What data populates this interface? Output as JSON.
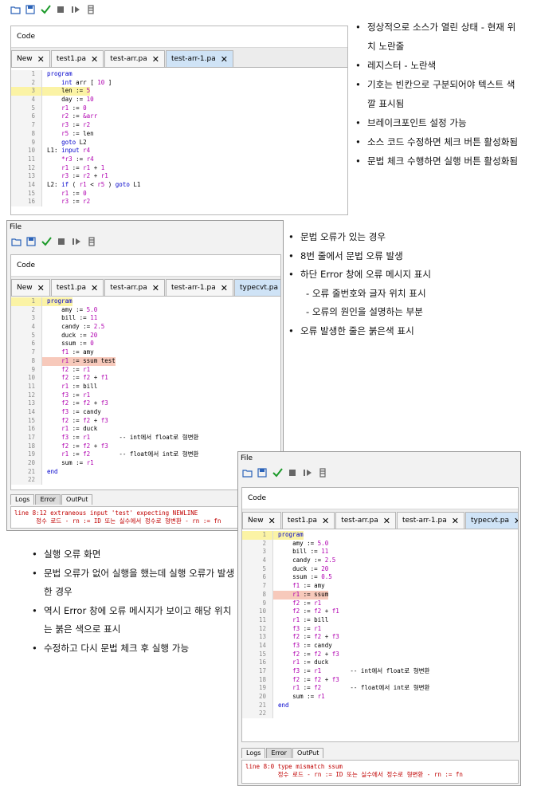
{
  "notes1": [
    "정상적으로 소스가 열린 상태 - 현재 위치 노란줄",
    "레지스터 - 노란색",
    "기호는 빈칸으로 구분되어야 텍스트 색깔 표시됨",
    "브레이크포인트 설정 가능",
    "소스 코드 수정하면 체크 버튼 활성화됨",
    "문법 체크 수행하면 실행 버튼 활성화됨"
  ],
  "notes2": [
    "문법 오류가 있는 경우",
    "8번 줄에서 문법 오류 발생",
    "하단 Error 창에 오류 메시지 표시",
    "- 오류 줄번호와 글자 위치 표시",
    "- 오류의 원인을 설명하는 부분",
    "오류 발생한 줄은 붉은색 표시"
  ],
  "notes3": [
    "실행 오류 화면",
    "문법 오류가 없어 실행을 했는데 실행 오류가 발생한 경우",
    "역시 Error 창에 오류 메시지가 보이고 해당 위치는 붉은 색으로 표시",
    "수정하고 다시 문법 체크 후 실행 가능"
  ],
  "icons": {
    "open": "folder-open-icon",
    "save": "save-icon",
    "check": "check-icon",
    "stop": "stop-icon",
    "run": "step-run-icon",
    "debug": "debug-icon"
  },
  "colors": {
    "current_line": "#fbf3a5",
    "error_line": "#f7c9bb",
    "active_tab": "#cfe3f6",
    "keyword": "#0000cc",
    "register": "#b000b0",
    "error_text": "#c00000"
  },
  "win1": {
    "panel_title": "Code",
    "tabs": [
      {
        "label": "New",
        "active": false
      },
      {
        "label": "test1.pa",
        "active": false
      },
      {
        "label": "test-arr.pa",
        "active": false
      },
      {
        "label": "test-arr-1.pa",
        "active": true
      }
    ],
    "current_line": 3,
    "error_line": null,
    "lines": [
      [
        "1",
        "",
        "program"
      ],
      [
        "2",
        "",
        "    int arr [ 10 ]"
      ],
      [
        "3",
        "",
        "    len := 5"
      ],
      [
        "4",
        "",
        "    day := 10"
      ],
      [
        "5",
        "",
        "    r1 := 0"
      ],
      [
        "6",
        "",
        "    r2 := &arr"
      ],
      [
        "7",
        "",
        "    r3 := r2"
      ],
      [
        "8",
        "",
        "    r5 := len"
      ],
      [
        "9",
        "",
        "    goto L2"
      ],
      [
        "10",
        "",
        "L1: input r4"
      ],
      [
        "11",
        "",
        "    *r3 := r4"
      ],
      [
        "12",
        "",
        "    r1 := r1 + 1"
      ],
      [
        "13",
        "",
        "    r3 := r2 + r1"
      ],
      [
        "14",
        "",
        "L2: if ( r1 < r5 ) goto L1"
      ],
      [
        "15",
        "",
        "    r1 := 0"
      ],
      [
        "16",
        "",
        "    r3 := r2"
      ]
    ]
  },
  "win2": {
    "menu": "File",
    "panel_title": "Code",
    "tabs": [
      {
        "label": "New",
        "active": false
      },
      {
        "label": "test1.pa",
        "active": false
      },
      {
        "label": "test-arr.pa",
        "active": false
      },
      {
        "label": "test-arr-1.pa",
        "active": false
      },
      {
        "label": "typecvt.pa",
        "active": true
      }
    ],
    "current_line": 1,
    "error_line": 8,
    "lines": [
      [
        "1",
        "",
        "program"
      ],
      [
        "2",
        "",
        "    amy := 5.0"
      ],
      [
        "3",
        "",
        "    bill := 11"
      ],
      [
        "4",
        "",
        "    candy := 2.5"
      ],
      [
        "5",
        "",
        "    duck := 20"
      ],
      [
        "6",
        "",
        "    ssum := 0"
      ],
      [
        "7",
        "",
        "    f1 := amy"
      ],
      [
        "8",
        "",
        "    r1 := ssum test"
      ],
      [
        "9",
        "",
        "    f2 := r1"
      ],
      [
        "10",
        "",
        "    f2 := f2 + f1"
      ],
      [
        "11",
        "",
        "    r1 := bill"
      ],
      [
        "12",
        "",
        "    f3 := r1"
      ],
      [
        "13",
        "",
        "    f2 := f2 + f3"
      ],
      [
        "14",
        "",
        "    f3 := candy"
      ],
      [
        "15",
        "",
        "    f2 := f2 + f3"
      ],
      [
        "16",
        "",
        "    r1 := duck"
      ],
      [
        "17",
        "",
        "    f3 := r1        -- int에서 float로 형변환"
      ],
      [
        "18",
        "",
        "    f2 := f2 + f3"
      ],
      [
        "19",
        "",
        "    r1 := f2        -- float에서 int로 형변환"
      ],
      [
        "20",
        "",
        "    sum := r1"
      ],
      [
        "21",
        "",
        "end"
      ],
      [
        "22",
        "",
        ""
      ]
    ],
    "bottom_tabs": [
      {
        "label": "Logs",
        "active": false
      },
      {
        "label": "Error",
        "active": true
      },
      {
        "label": "OutPut",
        "active": false
      }
    ],
    "error_lines": [
      "line 8:12 extraneous input 'test' expecting NEWLINE",
      "      정수 로드 - rn := ID 또는 실수에서 정수로 형변환 - rn := fn"
    ]
  },
  "win3": {
    "menu": "File",
    "panel_title": "Code",
    "tabs": [
      {
        "label": "New",
        "active": false
      },
      {
        "label": "test1.pa",
        "active": false
      },
      {
        "label": "test-arr.pa",
        "active": false
      },
      {
        "label": "test-arr-1.pa",
        "active": false
      },
      {
        "label": "typecvt.pa",
        "active": true
      }
    ],
    "current_line": 1,
    "error_line": 8,
    "lines": [
      [
        "1",
        "",
        "program"
      ],
      [
        "2",
        "",
        "    amy := 5.0"
      ],
      [
        "3",
        "",
        "    bill := 11"
      ],
      [
        "4",
        "",
        "    candy := 2.5"
      ],
      [
        "5",
        "",
        "    duck := 20"
      ],
      [
        "6",
        "",
        "    ssum := 0.5"
      ],
      [
        "7",
        "",
        "    f1 := amy"
      ],
      [
        "8",
        "",
        "    r1 := ssum"
      ],
      [
        "9",
        "",
        "    f2 := r1"
      ],
      [
        "10",
        "",
        "    f2 := f2 + f1"
      ],
      [
        "11",
        "",
        "    r1 := bill"
      ],
      [
        "12",
        "",
        "    f3 := r1"
      ],
      [
        "13",
        "",
        "    f2 := f2 + f3"
      ],
      [
        "14",
        "",
        "    f3 := candy"
      ],
      [
        "15",
        "",
        "    f2 := f2 + f3"
      ],
      [
        "16",
        "",
        "    r1 := duck"
      ],
      [
        "17",
        "",
        "    f3 := r1        -- int에서 float로 형변환"
      ],
      [
        "18",
        "",
        "    f2 := f2 + f3"
      ],
      [
        "19",
        "",
        "    r1 := f2        -- float에서 int로 형변환"
      ],
      [
        "20",
        "",
        "    sum := r1"
      ],
      [
        "21",
        "",
        "end"
      ],
      [
        "22",
        "",
        ""
      ]
    ],
    "bottom_tabs": [
      {
        "label": "Logs",
        "active": false
      },
      {
        "label": "Error",
        "active": true
      },
      {
        "label": "OutPut",
        "active": false
      }
    ],
    "error_lines": [
      "line 8:0 type mismatch ssum",
      "         정수 로드 - rn := ID 또는 실수에서 정수로 형변환 - rn := fn"
    ]
  }
}
